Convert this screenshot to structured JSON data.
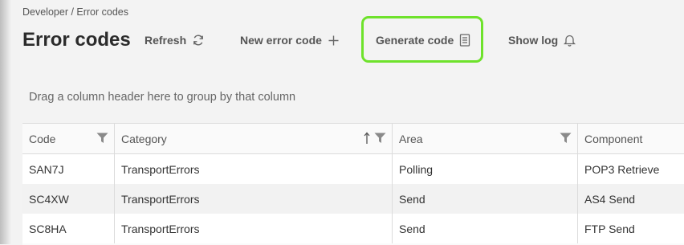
{
  "breadcrumb": "Developer / Error codes",
  "page_title": "Error codes",
  "toolbar": {
    "refresh_label": "Refresh",
    "new_label": "New error code",
    "generate_label": "Generate code",
    "showlog_label": "Show log"
  },
  "group_hint": "Drag a column header here to group by that column",
  "table": {
    "columns": [
      "Code",
      "Category",
      "Area",
      "Component"
    ],
    "rows": [
      [
        "SAN7J",
        "TransportErrors",
        "Polling",
        "POP3 Retrieve"
      ],
      [
        "SC4XW",
        "TransportErrors",
        "Send",
        "AS4 Send"
      ],
      [
        "SC8HA",
        "TransportErrors",
        "Send",
        "FTP Send"
      ]
    ]
  },
  "colors": {
    "highlight": "#6ee22b",
    "background": "#f3f3f3"
  },
  "icons": {
    "refresh": "refresh-icon",
    "new": "plus-icon",
    "generate": "document-icon",
    "showlog": "bell-icon",
    "filter": "filter-icon",
    "sort": "sort-ascending-icon"
  }
}
